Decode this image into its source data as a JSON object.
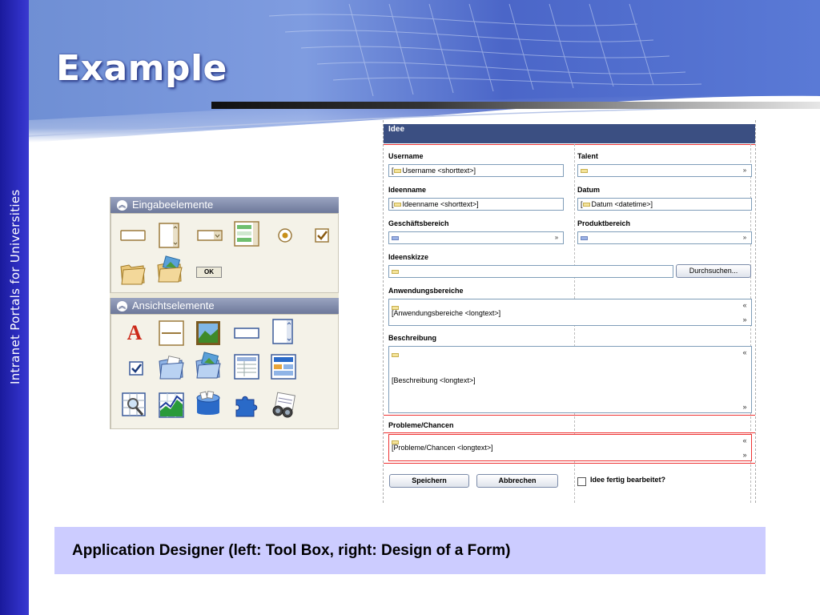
{
  "slide": {
    "title": "Example",
    "side_text": "Intranet  Portals for Universities",
    "caption": "Application Designer (left: Tool Box, right: Design of a Form)",
    "colors": {
      "side_bar": "#2f2fc4",
      "caption_bg": "#ccccff",
      "form_header": "#3b4f82"
    }
  },
  "toolbox": {
    "input_section": "Eingabeelemente",
    "view_section": "Ansichtselemente",
    "input_icons": [
      "textbox-icon",
      "textarea-icon",
      "dropdown-icon",
      "listbox-icon",
      "radio-icon",
      "checkbox-icon",
      "file-upload-icon",
      "image-upload-icon",
      "ok-button-icon"
    ],
    "ok_label": "OK",
    "view_icons": [
      "text-label-icon",
      "line-icon",
      "image-icon",
      "textfield-view-icon",
      "scroll-view-icon",
      "checkbox-view-icon",
      "file-view-icon",
      "image-view-icon",
      "table-view-icon",
      "layout-view-icon",
      "search-grid-icon",
      "chart-icon",
      "database-icon",
      "puzzle-icon",
      "binoculars-icon"
    ],
    "text_label_glyph": "A"
  },
  "form": {
    "title": "Idee",
    "fields": {
      "username_label": "Username",
      "username_value": "Username <shorttext>]",
      "username_lead": "[",
      "talent_label": "Talent",
      "ideenname_label": "Ideenname",
      "ideenname_lead": "[",
      "ideenname_value": "Ideenname <shorttext>]",
      "datum_label": "Datum",
      "datum_lead": "[",
      "datum_value": "Datum <datetime>]",
      "geschaeftsbereich_label": "Geschäftsbereich",
      "produktbereich_label": "Produktbereich",
      "ideenskizze_label": "Ideenskizze",
      "browse_button": "Durchsuchen...",
      "anwendungsbereiche_label": "Anwendungsbereiche",
      "anwendungsbereiche_value": "[Anwendungsbereiche <longtext>]",
      "beschreibung_label": "Beschreibung",
      "beschreibung_value": "[Beschreibung <longtext>]",
      "probleme_label": "Probleme/Chancen",
      "probleme_value": "[Probleme/Chancen <longtext>]"
    },
    "save_button": "Speichern",
    "cancel_button": "Abbrechen",
    "done_checkbox_label": "Idee fertig bearbeitet?",
    "dropdown_glyph": "»",
    "scroll_up_glyph": "«",
    "scroll_down_glyph": "»"
  }
}
